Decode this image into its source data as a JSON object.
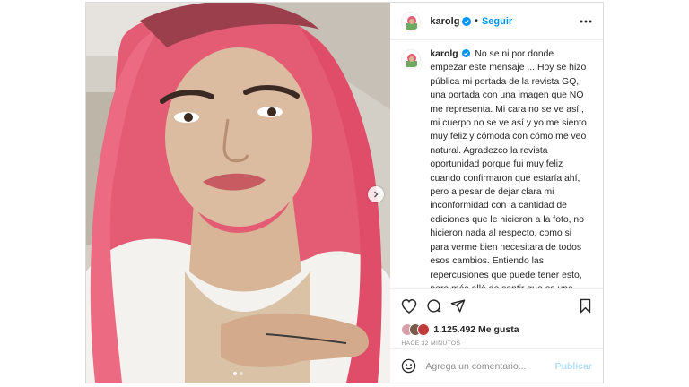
{
  "post": {
    "username": "karolg",
    "follow_label": "Seguir",
    "separator": "•",
    "caption": {
      "username": "karolg",
      "text": "No se ni por donde empezar este mensaje ... Hoy se hizo pública mi portada de la revista GQ, una portada con una imagen que NO me representa. Mi cara no se ve así , mi cuerpo no se ve así y yo me siento muy feliz y cómoda con cómo me veo natural. Agradezco la revista oportunidad porque fui muy feliz cuando confirmaron que estaría ahí, pero a pesar de dejar clara mi inconformidad con la cantidad de ediciones que le hicieron a la foto, no hicieron nada al respecto, como si para verme bien necesitara de todos esos cambios. Entiendo las repercusiones que puede tener esto, pero más allá de sentir que es una falta de respeto a mi , es a las mujeres que todos los días nos despertamos buscando sentirnos cómodas con nosotras mismas a pesar"
    },
    "likes": "1.125.492 Me gusta",
    "time": "HACE 32 MINUTOS",
    "comment_placeholder": "Agrega un comentario...",
    "publish_label": "Publicar",
    "carousel": {
      "total": 2,
      "active": 1
    }
  },
  "icons": {
    "verified": "verified-badge-icon",
    "more": "more-options-icon",
    "like": "heart-icon",
    "comment": "comment-icon",
    "share": "send-icon",
    "save": "bookmark-icon",
    "emoji": "emoji-icon",
    "next": "chevron-right-icon"
  },
  "colors": {
    "accent": "#0095f6",
    "publish_disabled": "#b2dffc",
    "muted": "#8e8e8e",
    "hair": "#e85a72"
  }
}
